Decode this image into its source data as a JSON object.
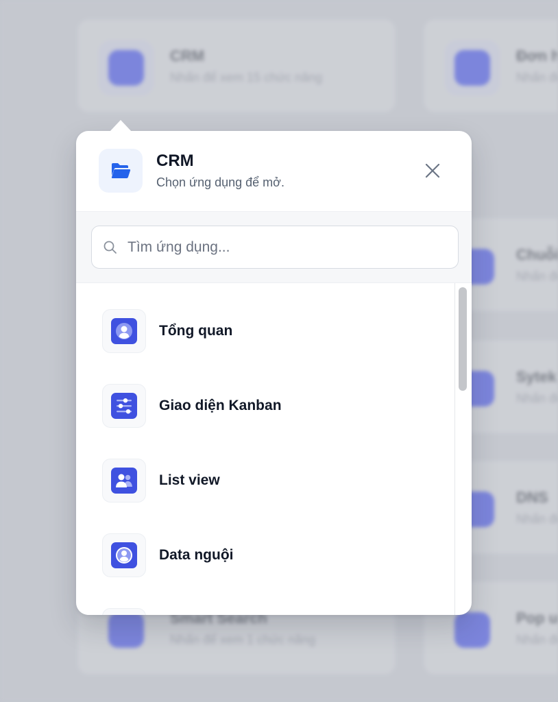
{
  "background": {
    "cards": [
      {
        "title": "CRM",
        "subtitle": "Nhấn để xem 15 chức năng"
      },
      {
        "title": "Đơn hàng",
        "subtitle": "Nhấn để xem"
      },
      {
        "title": "Chuỗi",
        "subtitle": "Nhấn để"
      },
      {
        "title": "Sytek",
        "subtitle": "Nhấn để"
      },
      {
        "title": "DNS",
        "subtitle": "Nhấn để"
      },
      {
        "title": "Smart Search",
        "subtitle": "Nhấn để xem 1 chức năng"
      },
      {
        "title": "Pop up",
        "subtitle": "Nhấn để"
      }
    ]
  },
  "popover": {
    "title": "CRM",
    "subtitle": "Chọn ứng dụng để mở.",
    "header_icon": "folder-open-icon",
    "close_icon": "close-icon",
    "search": {
      "placeholder": "Tìm ứng dụng...",
      "value": "",
      "icon": "search-icon"
    },
    "items": [
      {
        "label": "Tổng quan",
        "icon": "user-icon"
      },
      {
        "label": "Giao diện Kanban",
        "icon": "sliders-icon"
      },
      {
        "label": "List view",
        "icon": "users-icon"
      },
      {
        "label": "Data nguội",
        "icon": "user-circle-icon"
      },
      {
        "label": "",
        "icon": "app-icon"
      }
    ]
  },
  "colors": {
    "accent": "#3f51e0",
    "folder": "#2563eb",
    "text": "#111827",
    "muted": "#556070"
  }
}
